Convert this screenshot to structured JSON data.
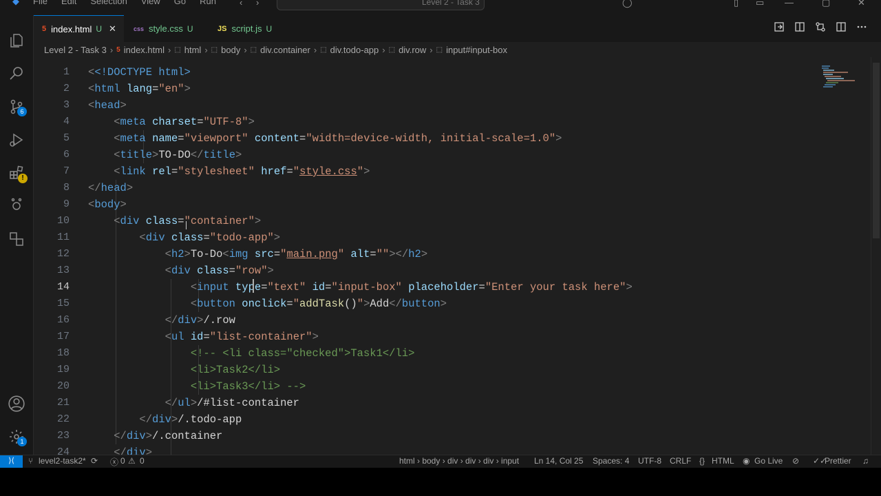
{
  "titlebar": {
    "menu": [
      "File",
      "Edit",
      "Selection",
      "View",
      "Go",
      "Run"
    ],
    "search_placeholder": "Level 2 - Task 3"
  },
  "activity": {
    "source_control_badge": "6",
    "settings_badge": "1"
  },
  "tabs": [
    {
      "icon": "html-icon",
      "label": "index.html",
      "status": "U",
      "active": true
    },
    {
      "icon": "css-icon",
      "label": "style.css",
      "status": "U",
      "active": false
    },
    {
      "icon": "js-icon",
      "label": "script.js",
      "status": "U",
      "active": false
    }
  ],
  "breadcrumb": [
    "Level 2 - Task 3",
    "index.html",
    "html",
    "body",
    "div.container",
    "div.todo-app",
    "div.row",
    "input#input-box"
  ],
  "editor": {
    "current_line": "14",
    "line_numbers": [
      "1",
      "2",
      "3",
      "4",
      "5",
      "6",
      "7",
      "8",
      "9",
      "10",
      "11",
      "12",
      "13",
      "14",
      "15",
      "16",
      "17",
      "18",
      "19",
      "20",
      "21",
      "22",
      "23",
      "24"
    ],
    "code": {
      "l1_doctype": "<!DOCTYPE html>",
      "l2_tag": "html",
      "l2_attr": "lang",
      "l2_val": "\"en\"",
      "l3_tag": "head",
      "l4_tag": "meta",
      "l4_attr": "charset",
      "l4_val": "\"UTF-8\"",
      "l5_tag": "meta",
      "l5_attr1": "name",
      "l5_val1": "\"viewport\"",
      "l5_attr2": "content",
      "l5_val2": "\"width=device-width, initial-scale=1.0\"",
      "l6_tag": "title",
      "l6_text": "TO-DO",
      "l7_tag": "link",
      "l7_attr1": "rel",
      "l7_val1": "\"stylesheet\"",
      "l7_attr2": "href",
      "l7_val2a": "\"",
      "l7_val2b": "style.css",
      "l7_val2c": "\"",
      "l8_tag": "head",
      "l9_tag": "body",
      "l10_tag": "div",
      "l10_attr": "class",
      "l10_val": "\"container\"",
      "l11_tag": "div",
      "l11_attr": "class",
      "l11_val": "\"todo-app\"",
      "l12_tag": "h2",
      "l12_text": "To-Do",
      "l12_img": "img",
      "l12_attr1": "src",
      "l12_val1a": "\"",
      "l12_val1b": "main.png",
      "l12_val1c": "\"",
      "l12_attr2": "alt",
      "l12_val2": "\"\"",
      "l13_tag": "div",
      "l13_attr": "class",
      "l13_val": "\"row\"",
      "l14_tag": "input",
      "l14_attr1": "type",
      "l14_val1": "\"text\"",
      "l14_attr2": "id",
      "l14_val2": "\"input-box\"",
      "l14_attr3": "placeholder",
      "l14_val3": "\"Enter your task here\"",
      "l15_tag": "button",
      "l15_attr": "onclick",
      "l15_val_q": "\"",
      "l15_fn": "addTask",
      "l15_paren": "()",
      "l15_text": "Add",
      "l16_tag": "div",
      "l16_comment": "/.row",
      "l17_tag": "ul",
      "l17_attr": "id",
      "l17_val": "\"list-container\"",
      "l18_comment": "<!-- <li class=\"checked\">Task1</li>",
      "l19_comment": "<li>Task2</li>",
      "l20_comment": "<li>Task3</li> -->",
      "l21_tag": "ul",
      "l21_comment": "/#list-container",
      "l22_tag": "div",
      "l22_comment": "/.todo-app",
      "l23_tag": "div",
      "l23_comment": "/.container",
      "l24_tag": "div"
    }
  },
  "statusbar": {
    "branch": "level2-task2*",
    "errors": "0",
    "warnings": "0",
    "path": "html › body › div › div › div › input",
    "position": "Ln 14, Col 25",
    "spaces": "Spaces: 4",
    "encoding": "UTF-8",
    "eol": "CRLF",
    "language": "HTML",
    "golive": "Go Live",
    "prettier": "Prettier"
  },
  "colors": {
    "accent": "#0078d4",
    "html_icon": "#e44d26",
    "css_icon": "#a074c4",
    "js_icon": "#f1e05a",
    "untracked": "#73c991"
  }
}
